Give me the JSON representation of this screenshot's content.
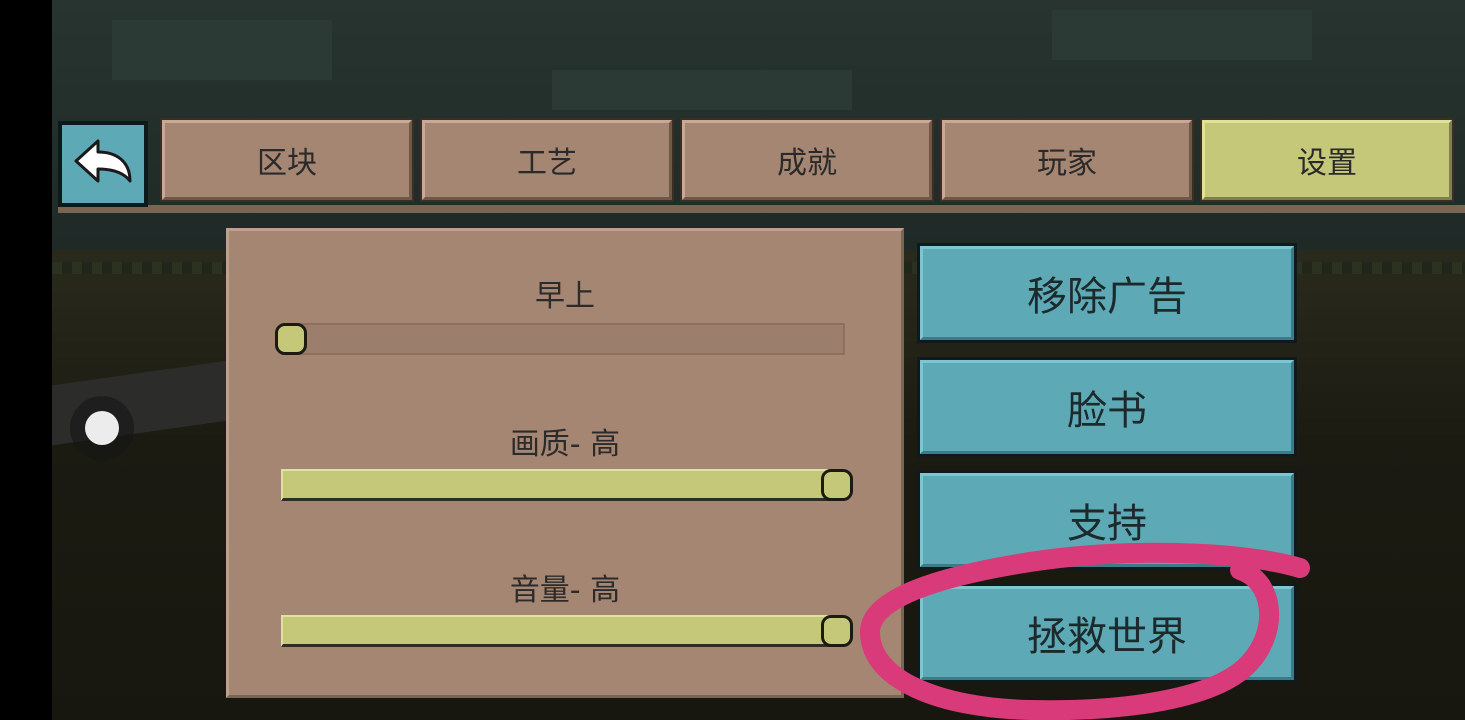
{
  "tabs": [
    {
      "label": "区块",
      "active": false
    },
    {
      "label": "工艺",
      "active": false
    },
    {
      "label": "成就",
      "active": false
    },
    {
      "label": "玩家",
      "active": false
    },
    {
      "label": "设置",
      "active": true
    }
  ],
  "back_icon": "back-arrow-icon",
  "settings": {
    "time_label": "早上",
    "time_value": 0.0,
    "quality_label": "画质- 高",
    "quality_value": 1.0,
    "volume_label": "音量- 高",
    "volume_value": 1.0
  },
  "buttons": {
    "remove_ads": "移除广告",
    "facebook": "脸书",
    "support": "支持",
    "save_world": "拯救世界"
  },
  "colors": {
    "tab_brown": "#a58672",
    "tab_active": "#c5c878",
    "button_teal": "#5daab6",
    "annotation_pink": "#d83a7a"
  }
}
